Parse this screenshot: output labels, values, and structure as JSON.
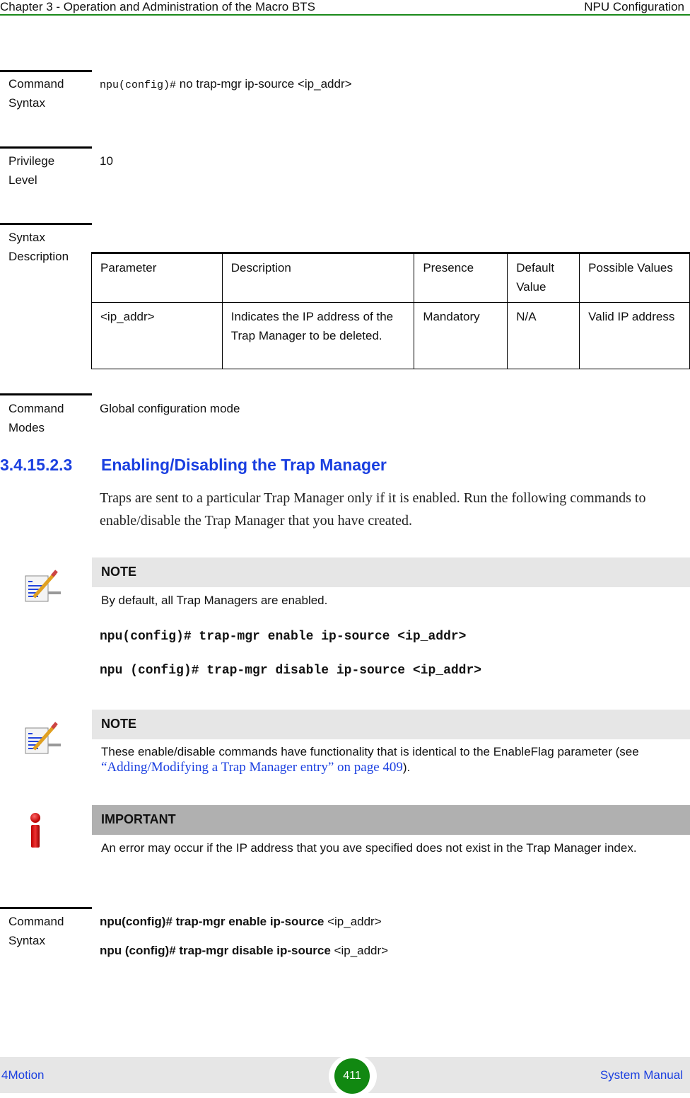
{
  "header": {
    "chapter": "Chapter 3 - Operation and Administration of the Macro BTS",
    "section": "NPU Configuration",
    "rule_color": "#1a8a1a"
  },
  "block1": {
    "label_line1": "Command",
    "label_line2": "Syntax",
    "prompt": "npu(config)#",
    "command": " no trap-mgr ip-source <ip_addr>"
  },
  "block2": {
    "label_line1": "Privilege",
    "label_line2": "Level",
    "value": "10"
  },
  "block3": {
    "label_line1": "Syntax",
    "label_line2": "Description",
    "table": {
      "headers": [
        "Parameter",
        "Description",
        "Presence",
        "Default Value",
        "Possible Values"
      ],
      "rows": [
        [
          "<ip_addr>",
          "Indicates the IP address of the Trap Manager to be deleted.",
          "Mandatory",
          "N/A",
          "Valid IP address"
        ]
      ]
    }
  },
  "block4": {
    "label_line1": "Command",
    "label_line2": "Modes",
    "value": "Global configuration mode"
  },
  "section": {
    "number": "3.4.15.2.3",
    "title": "Enabling/Disabling the Trap Manager",
    "color": "#1a3fe0",
    "body": "Traps are sent to a particular Trap Manager only if it is enabled. Run the following commands to enable/disable the Trap Manager that you have created."
  },
  "note1": {
    "icon": "note-pencil-icon",
    "title": "NOTE",
    "body": "By default, all Trap Managers are enabled."
  },
  "commands": [
    "npu(config)# trap-mgr enable ip-source <ip_addr>",
    "npu (config)# trap-mgr disable ip-source <ip_addr>"
  ],
  "note2": {
    "icon": "note-pencil-icon",
    "title": "NOTE",
    "body_before": "These enable/disable commands have functionality that is identical to the EnableFlag parameter (see ",
    "link": "“Adding/Modifying a Trap Manager entry” on page 409",
    "body_after": ")."
  },
  "important": {
    "icon": "important-info-icon",
    "title": "IMPORTANT",
    "body": "An error may occur if the IP address that you ave specified does not exist in the Trap Manager index."
  },
  "block5": {
    "label_line1": "Command",
    "label_line2": "Syntax",
    "lines": [
      {
        "bold": "npu(config)#  trap-mgr enable ip-source",
        "rest": " <ip_addr>"
      },
      {
        "bold": "npu (config)# trap-mgr disable ip-source",
        "rest": " <ip_addr>"
      }
    ]
  },
  "footer": {
    "left": "4Motion",
    "page": "411",
    "right": "System Manual",
    "page_color": "#118811"
  }
}
